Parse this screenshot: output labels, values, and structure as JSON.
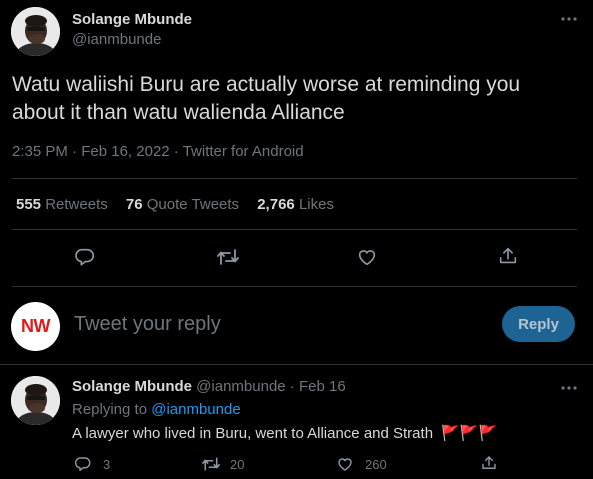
{
  "tweet": {
    "author_name": "Solange Mbunde",
    "author_handle": "@ianmbunde",
    "text_line1": "Watu waliishi Buru are actually worse at reminding you",
    "text_line2": "about it than watu walienda Alliance",
    "time": "2:35 PM",
    "date": "Feb 16, 2022",
    "source": "Twitter for Android",
    "separator": "·"
  },
  "stats": {
    "retweets_count": "555",
    "retweets_label": "Retweets",
    "quotes_count": "76",
    "quotes_label": "Quote Tweets",
    "likes_count": "2,766",
    "likes_label": "Likes"
  },
  "composer": {
    "avatar_text": "NW",
    "placeholder": "Tweet your reply",
    "reply_button": "Reply"
  },
  "reply": {
    "author_name": "Solange Mbunde",
    "author_handle": "@ianmbunde",
    "separator": "·",
    "date": "Feb 16",
    "replying_prefix": "Replying to",
    "replying_handle": "@ianmbunde",
    "text": "A lawyer who lived in Buru, went to Alliance and Strath",
    "flags": "🚩🚩🚩",
    "reply_count": "3",
    "retweet_count": "20",
    "like_count": "260"
  },
  "colors": {
    "background": "#000000",
    "text": "#d9d9d9",
    "muted": "#6e767d",
    "link": "#1d9bf0",
    "divider": "#2f3336",
    "reply_button": "#1d6394"
  },
  "icons": [
    "more-icon",
    "reply-icon",
    "retweet-icon",
    "like-icon",
    "share-icon"
  ]
}
